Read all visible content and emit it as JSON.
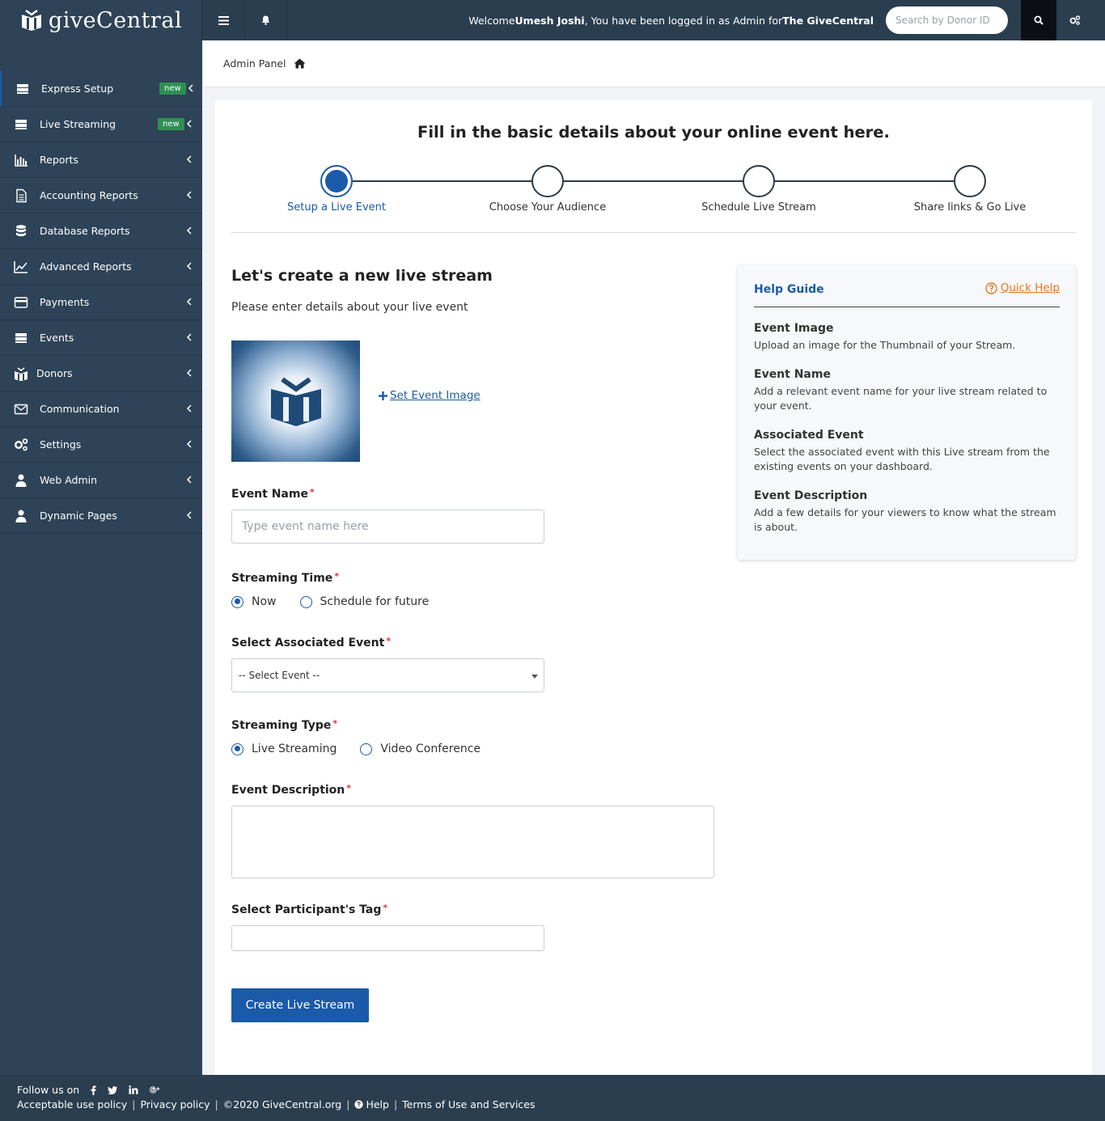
{
  "header": {
    "logo_text": "giveCentral",
    "welcome_prefix": "Welcome ",
    "user_name": "Umesh Joshi",
    "welcome_middle": ", You have been logged in as Admin for ",
    "org_name": "The GiveCentral",
    "search_placeholder": "Search by Donor ID"
  },
  "sidebar": {
    "items": [
      {
        "label": "Express Setup",
        "icon": "server-icon",
        "badge": "new"
      },
      {
        "label": "Live Streaming",
        "icon": "server-icon",
        "badge": "new"
      },
      {
        "label": "Reports",
        "icon": "bar-chart-icon"
      },
      {
        "label": "Accounting Reports",
        "icon": "document-icon"
      },
      {
        "label": "Database Reports",
        "icon": "database-icon"
      },
      {
        "label": "Advanced Reports",
        "icon": "line-chart-icon"
      },
      {
        "label": "Payments",
        "icon": "credit-card-icon"
      },
      {
        "label": "Events",
        "icon": "server-icon"
      },
      {
        "label": "Donors",
        "icon": "donors-icon"
      },
      {
        "label": "Communication",
        "icon": "envelope-icon"
      },
      {
        "label": "Settings",
        "icon": "gears-icon"
      },
      {
        "label": "Web Admin",
        "icon": "user-icon"
      },
      {
        "label": "Dynamic Pages",
        "icon": "user-icon"
      }
    ]
  },
  "breadcrumb": {
    "label": "Admin Panel"
  },
  "main": {
    "title": "Fill in the basic details about your online event here.",
    "steps": [
      {
        "label": "Setup a Live Event",
        "active": true
      },
      {
        "label": "Choose Your Audience",
        "active": false
      },
      {
        "label": "Schedule Live Stream",
        "active": false
      },
      {
        "label": "Share links & Go Live",
        "active": false
      }
    ],
    "section_title": "Let's create a new live stream",
    "section_subtitle": "Please enter details about your live event",
    "set_image_label": "Set Event Image",
    "event_name": {
      "label": "Event Name",
      "placeholder": "Type event name here",
      "value": ""
    },
    "streaming_time": {
      "label": "Streaming Time",
      "options": [
        "Now",
        "Schedule for future"
      ],
      "selected": "Now"
    },
    "associated_event": {
      "label": "Select Associated Event",
      "selected": "-- Select Event --"
    },
    "streaming_type": {
      "label": "Streaming Type",
      "options": [
        "Live Streaming",
        "Video Conference"
      ],
      "selected": "Live Streaming"
    },
    "event_description": {
      "label": "Event Description",
      "value": ""
    },
    "participants_tag": {
      "label": "Select Participant's Tag",
      "value": ""
    },
    "submit_label": "Create Live Stream",
    "required_mark": "*"
  },
  "help_guide": {
    "title": "Help Guide",
    "quick_help": "Quick Help",
    "items": [
      {
        "title": "Event Image",
        "desc": "Upload an image for the Thumbnail of your Stream."
      },
      {
        "title": "Event Name",
        "desc": "Add a relevant event name for your live stream related to your event."
      },
      {
        "title": "Associated Event",
        "desc": "Select the associated event with this Live stream from the existing events on your dashboard."
      },
      {
        "title": "Event Description",
        "desc": "Add a few details for your viewers to know what the stream is about."
      }
    ]
  },
  "footer": {
    "follow_label": "Follow us on",
    "links": [
      "Acceptable use policy",
      "Privacy policy",
      "©2020 GiveCentral.org",
      "Help",
      "Terms of Use and Services"
    ]
  },
  "colors": {
    "primary": "#1a5aa8",
    "sidebar": "#2e4357",
    "topbar": "#2b3e50",
    "badge": "#2f8f53",
    "quick_help": "#e8751a",
    "required": "#dd3333"
  }
}
